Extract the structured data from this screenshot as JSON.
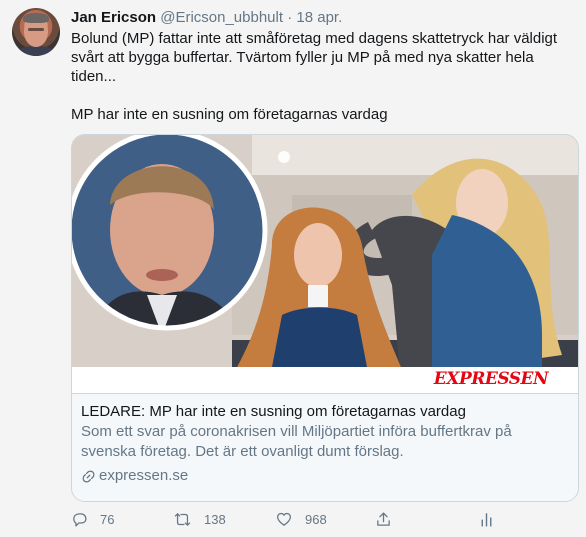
{
  "tweet": {
    "author_name": "Jan Ericson",
    "handle": "@Ericson_ubbhult",
    "separator": "·",
    "date": "18 apr.",
    "text_lines": [
      "Bolund (MP) fattar inte att småföretag med dagens skattetryck har väldigt svårt att bygga buffertar. Tvärtom fyller ju MP på med nya skatter hela tiden...",
      "MP har inte en susning om företagarnas vardag"
    ]
  },
  "card": {
    "logo_text": "EXPRESSEN",
    "title": "LEDARE: MP har inte en susning om företagarnas vardag",
    "description": "Som ett svar på coronakrisen vill Miljöpartiet införa buffertkrav på svenska företag. Det är ett ovanligt dumt förslag.",
    "domain": "expressen.se"
  },
  "actions": {
    "reply_count": "76",
    "retweet_count": "138",
    "like_count": "968"
  },
  "colors": {
    "text": "#14171a",
    "muted": "#657786",
    "border": "#ccd6dd",
    "brand_red": "#e30613"
  },
  "icons": [
    "reply-icon",
    "retweet-icon",
    "like-icon",
    "share-icon",
    "analytics-icon",
    "link-icon"
  ]
}
